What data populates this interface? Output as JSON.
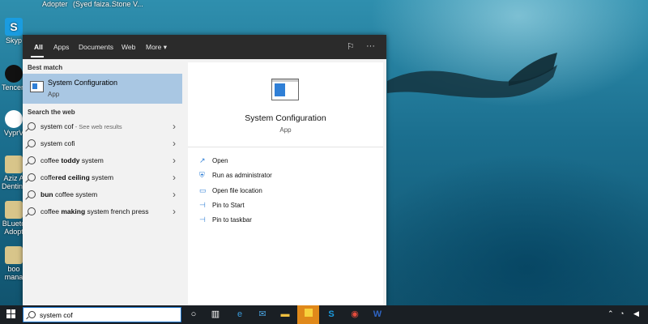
{
  "desktop": {
    "top_labels": [
      "Adopter",
      "(Syed faiza...",
      "Stone V..."
    ],
    "icons": [
      {
        "label": "Skyp",
        "icon": "skype-icon"
      },
      {
        "label": "Tencent",
        "icon": "tencent-icon"
      },
      {
        "label": "VyprV",
        "icon": "vyprvpn-icon"
      },
      {
        "label": "Aziz A Denting",
        "icon": "document-icon"
      },
      {
        "label": "BLueto Adopt",
        "icon": "document-icon"
      },
      {
        "label": "boo mana",
        "icon": "document-icon"
      }
    ]
  },
  "start_menu": {
    "tabs": [
      "All",
      "Apps",
      "Documents",
      "Web",
      "More"
    ],
    "more_icon": "▾",
    "best_match_header": "Best match",
    "best_match": {
      "title": "System Configuration",
      "subtitle": "App"
    },
    "search_web_header": "Search the web",
    "web_items": [
      {
        "text": "system cof",
        "bold": "",
        "hint": " - See web results"
      },
      {
        "text": "system cofi",
        "bold": "",
        "hint": ""
      },
      {
        "text": "coffee ",
        "bold": "toddy",
        "rest": " system"
      },
      {
        "text": "coffe",
        "bold": "red ceiling",
        "rest": " system"
      },
      {
        "text": "",
        "bold": "bun",
        "rest": " coffee system"
      },
      {
        "text": "coffee ",
        "bold": "making",
        "rest": " system french press"
      }
    ],
    "detail": {
      "title": "System Configuration",
      "subtitle": "App",
      "actions": [
        "Open",
        "Run as administrator",
        "Open file location",
        "Pin to Start",
        "Pin to taskbar"
      ]
    }
  },
  "taskbar": {
    "search_value": "system cof",
    "apps": [
      "cortana-icon",
      "task-view-icon",
      "edge-icon",
      "mail-icon",
      "file-explorer-icon",
      "sticky-notes-icon",
      "skype-icon",
      "chrome-icon",
      "word-icon"
    ]
  }
}
